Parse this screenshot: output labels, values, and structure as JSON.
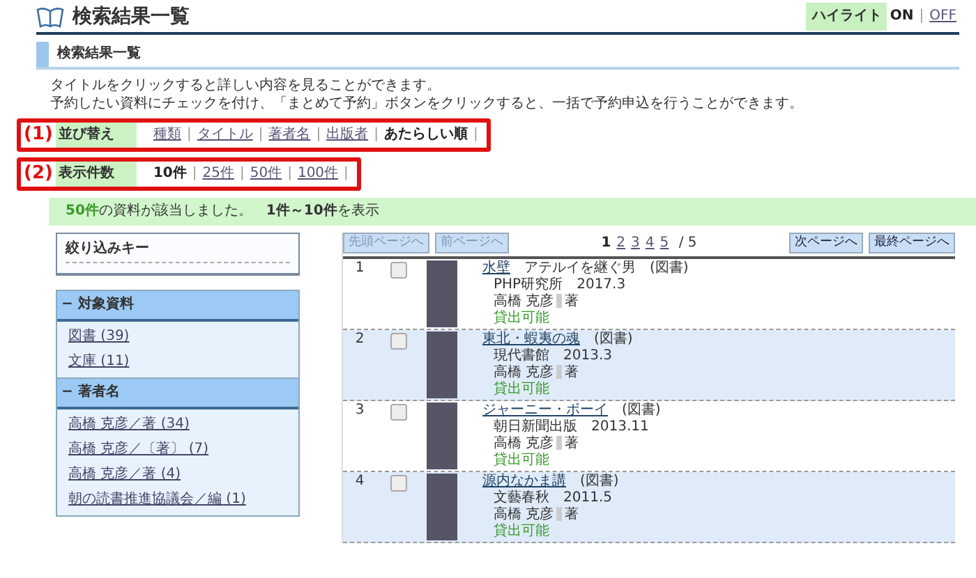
{
  "header": {
    "title": "検索結果一覧",
    "highlight": {
      "label": "ハイライト",
      "separator": "|",
      "options": [
        {
          "label": "ON",
          "selected": true
        },
        {
          "label": "OFF",
          "selected": false
        }
      ]
    }
  },
  "section": {
    "title": "検索結果一覧"
  },
  "instructions": [
    "タイトルをクリックすると詳しい内容を見ることができます。",
    "予約したい資料にチェックを付け、「まとめて予約」ボタンをクリックすると、一括で予約申込を行うことができます。"
  ],
  "sort": {
    "number": "(1)",
    "label": "並び替え",
    "separator": "|",
    "options": [
      {
        "label": "種類",
        "selected": false
      },
      {
        "label": "タイトル",
        "selected": false
      },
      {
        "label": "著者名",
        "selected": false
      },
      {
        "label": "出版者",
        "selected": false
      },
      {
        "label": "あたらしい順",
        "selected": true
      }
    ]
  },
  "page_size": {
    "number": "(2)",
    "label": "表示件数",
    "separator": "|",
    "options": [
      {
        "label": "10件",
        "selected": true
      },
      {
        "label": "25件",
        "selected": false
      },
      {
        "label": "50件",
        "selected": false
      },
      {
        "label": "100件",
        "selected": false
      }
    ]
  },
  "result_summary": "**50件**の資料が該当しました。　**1件～10件**を表示",
  "sidebar": {
    "title": "絞り込みキー",
    "facets": [
      {
        "marker": "−",
        "title": "対象資料",
        "items": [
          "図書 (39)",
          "文庫 (11)"
        ]
      },
      {
        "marker": "−",
        "title": "著者名",
        "items": [
          "高橋 克彦／著 (34)",
          "高橋 克彦／〔著〕 (7)",
          "高橋 克彦／著 (4)",
          "朝の読書推進協議会／編 (1)"
        ]
      }
    ]
  },
  "pager": {
    "first": "先頭ページへ",
    "prev": "前ページへ",
    "pages": [
      {
        "label": "1",
        "selected": true
      },
      {
        "label": "2",
        "selected": false
      },
      {
        "label": "3",
        "selected": false
      },
      {
        "label": "4",
        "selected": false
      },
      {
        "label": "5",
        "selected": false
      }
    ],
    "total": "/ 5",
    "next": "次ページへ",
    "last": "最終ページへ"
  },
  "results": [
    {
      "number": "1",
      "checked": false,
      "title": "水壁",
      "subtitle": "アテルイを継ぐ男",
      "type": "(図書)",
      "publisher": "PHP研究所",
      "date": "2017.3",
      "author": "高橋 克彦",
      "role": "著",
      "status": "貸出可能"
    },
    {
      "number": "2",
      "checked": false,
      "title": "東北・蝦夷の魂",
      "type": "(図書)",
      "publisher": "現代書館",
      "date": "2013.3",
      "author": "高橋 克彦",
      "role": "著",
      "status": "貸出可能"
    },
    {
      "number": "3",
      "checked": false,
      "title": "ジャーニー・ボーイ",
      "type": "(図書)",
      "publisher": "朝日新聞出版",
      "date": "2013.11",
      "author": "高橋 克彦",
      "role": "著",
      "status": "貸出可能"
    },
    {
      "number": "4",
      "checked": false,
      "title": "源内なかま講",
      "type": "(図書)",
      "publisher": "文藝春秋",
      "date": "2011.5",
      "author": "高橋 克彦",
      "role": "著",
      "status": "貸出可能"
    }
  ]
}
